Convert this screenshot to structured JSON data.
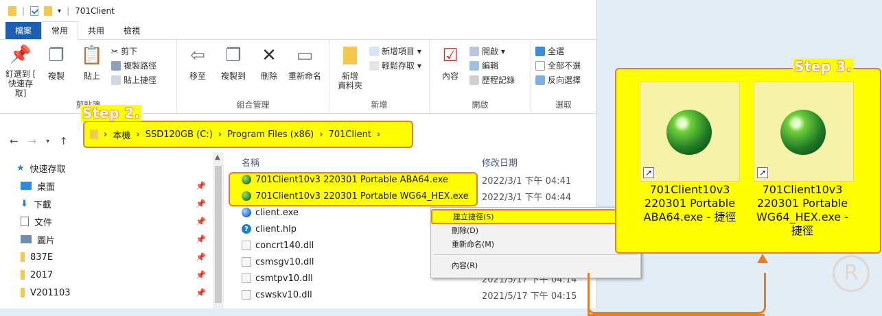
{
  "titlebar": {
    "title": "701Client"
  },
  "tabs": [
    "檔案",
    "常用",
    "共用",
    "檢視"
  ],
  "ribbon": {
    "clipboard": {
      "pin": "釘選到 [\n快速存取]",
      "copy": "複製",
      "paste": "貼上",
      "cut": "剪下",
      "copy_path": "複製路徑",
      "paste_shortcut": "貼上捷徑",
      "label": "剪貼簿"
    },
    "organize": {
      "move_to": "移至",
      "copy_to": "複製到",
      "delete": "刪除",
      "rename": "重新命名",
      "label": "組合管理"
    },
    "new": {
      "new_folder": "新增\n資料夾",
      "new_item": "新增項目 ▾",
      "easy_access": "輕鬆存取 ▾",
      "label": "新增"
    },
    "open": {
      "properties": "內容",
      "open": "開啟 ▾",
      "edit": "編輯",
      "history": "歷程記錄",
      "label": "開啟"
    },
    "select": {
      "select_all": "全選",
      "select_none": "全部不選",
      "invert": "反向選擇",
      "label": "選取"
    }
  },
  "address": {
    "crumbs": [
      "本機",
      "SSD120GB (C:)",
      "Program Files (x86)",
      "701Client"
    ]
  },
  "steps": {
    "step2": "Step 2.",
    "step3": "Step 3."
  },
  "nav": {
    "items": [
      {
        "label": "快速存取"
      },
      {
        "label": "桌面"
      },
      {
        "label": "下載"
      },
      {
        "label": "文件"
      },
      {
        "label": "圖片"
      },
      {
        "label": "837E"
      },
      {
        "label": "2017"
      },
      {
        "label": "V201103"
      }
    ]
  },
  "filelist": {
    "col_name": "名稱",
    "col_date": "修改日期",
    "rows": [
      {
        "name": "701Client10v3 220301 Portable ABA64.exe",
        "date": "2022/3/1 下午 04:41",
        "icon": "globe"
      },
      {
        "name": "701Client10v3 220301 Portable WG64_HEX.exe",
        "date": "2022/3/1 下午 04:44",
        "icon": "globe"
      },
      {
        "name": "client.exe",
        "date": "",
        "icon": "exe"
      },
      {
        "name": "client.hlp",
        "date": "",
        "icon": "help"
      },
      {
        "name": "concrt140.dll",
        "date": "",
        "icon": "dll"
      },
      {
        "name": "csmsgv10.dll",
        "date": "",
        "icon": "dll"
      },
      {
        "name": "csmtpv10.dll",
        "date": "2021/5/17 下午 04:14",
        "icon": "dll"
      },
      {
        "name": "cswskv10.dll",
        "date": "2021/5/17 下午 04:15",
        "icon": "dll"
      }
    ]
  },
  "context_menu": {
    "create_shortcut": "建立捷徑(S)",
    "delete": "刪除(D)",
    "rename": "重新命名(M)",
    "properties": "內容(R)"
  },
  "desktop": {
    "tiles": [
      {
        "label": "701Client10v3 220301 Portable ABA64.exe - 捷徑"
      },
      {
        "label": "701Client10v3 220301 Portable WG64_HEX.exe - 捷徑"
      }
    ]
  },
  "watermark": "R",
  "colors": {
    "highlight": "#ffff00",
    "outline": "#e67e22",
    "file_tab": "#1a5fb4"
  }
}
